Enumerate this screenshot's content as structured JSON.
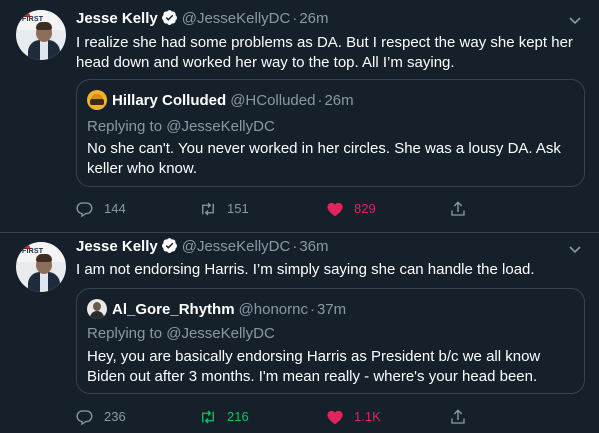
{
  "tweets": [
    {
      "author_name": "Jesse Kelly",
      "author_handle": "@JesseKellyDC",
      "separator": "·",
      "time": "26m",
      "text": "I realize she had some problems as DA. But I respect the way she kept her head down and worked her way to the top. All I’m saying.",
      "avatar_text": "FIRST",
      "quote": {
        "author_name": "Hillary Colluded",
        "author_handle": "@HColluded",
        "separator": "·",
        "time": "26m",
        "replying_to": "Replying to @JesseKellyDC",
        "text": "No she can't.  You never worked in her circles.  She was a lousy DA.  Ask keller who know."
      },
      "reply_count": "144",
      "retweet_count": "151",
      "like_count": "829",
      "liked": true,
      "retweeted": false
    },
    {
      "author_name": "Jesse Kelly",
      "author_handle": "@JesseKellyDC",
      "separator": "·",
      "time": "36m",
      "text": "I am not endorsing Harris. I’m simply saying she can handle the load.",
      "avatar_text": "FIRST",
      "quote": {
        "author_name": "Al_Gore_Rhythm",
        "author_handle": "@honornc",
        "separator": "·",
        "time": "37m",
        "replying_to": "Replying to @JesseKellyDC",
        "text": "Hey, you are basically endorsing Harris as President b/c we all know Biden out after 3 months.  I'm mean really - where's your head been."
      },
      "reply_count": "236",
      "retweet_count": "216",
      "like_count": "1.1K",
      "liked": true,
      "retweeted": true
    }
  ],
  "colors": {
    "background": "#15202b",
    "border": "#38444d",
    "secondary_text": "#8899a6",
    "like": "#e0245e",
    "retweet": "#17bf63",
    "verified": "#ffffff"
  }
}
